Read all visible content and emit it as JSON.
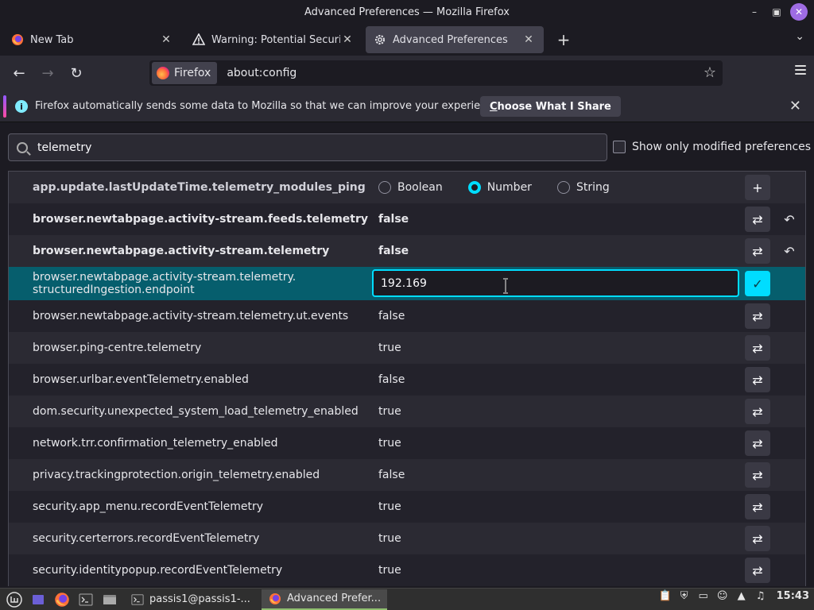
{
  "window": {
    "title": "Advanced Preferences — Mozilla Firefox"
  },
  "tabs": [
    {
      "label": "New Tab",
      "icon": "firefox-icon"
    },
    {
      "label": "Warning: Potential Security",
      "icon": "warning-icon"
    },
    {
      "label": "Advanced Preferences",
      "icon": "gear-icon",
      "active": true
    }
  ],
  "urlbar": {
    "identity_label": "Firefox",
    "url": "about:config"
  },
  "notification": {
    "message": "Firefox automatically sends some data to Mozilla so that we can improve your experience.",
    "button_prefix": "C",
    "button_rest": "hoose What I Share"
  },
  "search": {
    "value": "telemetry"
  },
  "modified_checkbox_label": "Show only modified preferences",
  "new_pref": {
    "name": "app.update.lastUpdateTime.telemetry_modules_ping",
    "types": [
      "Boolean",
      "Number",
      "String"
    ],
    "selected_type": "Number"
  },
  "prefs": [
    {
      "name": "browser.newtabpage.activity-stream.feeds.telemetry",
      "value": "false",
      "modified": true
    },
    {
      "name": "browser.newtabpage.activity-stream.telemetry",
      "value": "false",
      "modified": true
    },
    {
      "name_line1": "browser.newtabpage.activity-stream.telemetry.",
      "name_line2": "structuredIngestion.endpoint",
      "edit_value": "192.169",
      "editing": true
    },
    {
      "name": "browser.newtabpage.activity-stream.telemetry.ut.events",
      "value": "false"
    },
    {
      "name": "browser.ping-centre.telemetry",
      "value": "true"
    },
    {
      "name": "browser.urlbar.eventTelemetry.enabled",
      "value": "false"
    },
    {
      "name": "dom.security.unexpected_system_load_telemetry_enabled",
      "value": "true"
    },
    {
      "name": "network.trr.confirmation_telemetry_enabled",
      "value": "true"
    },
    {
      "name": "privacy.trackingprotection.origin_telemetry.enabled",
      "value": "false"
    },
    {
      "name": "security.app_menu.recordEventTelemetry",
      "value": "true"
    },
    {
      "name": "security.certerrors.recordEventTelemetry",
      "value": "true"
    },
    {
      "name": "security.identitypopup.recordEventTelemetry",
      "value": "true"
    }
  ],
  "taskbar": {
    "tasks": [
      {
        "label": "passis1@passis1-...",
        "icon": "terminal-icon"
      },
      {
        "label": "Advanced Prefer...",
        "icon": "firefox-icon",
        "active": true
      }
    ],
    "clock": "15:43"
  },
  "colors": {
    "accent": "#00ddff",
    "editing_row": "#065e6d",
    "close_button": "#9e6ce3"
  }
}
